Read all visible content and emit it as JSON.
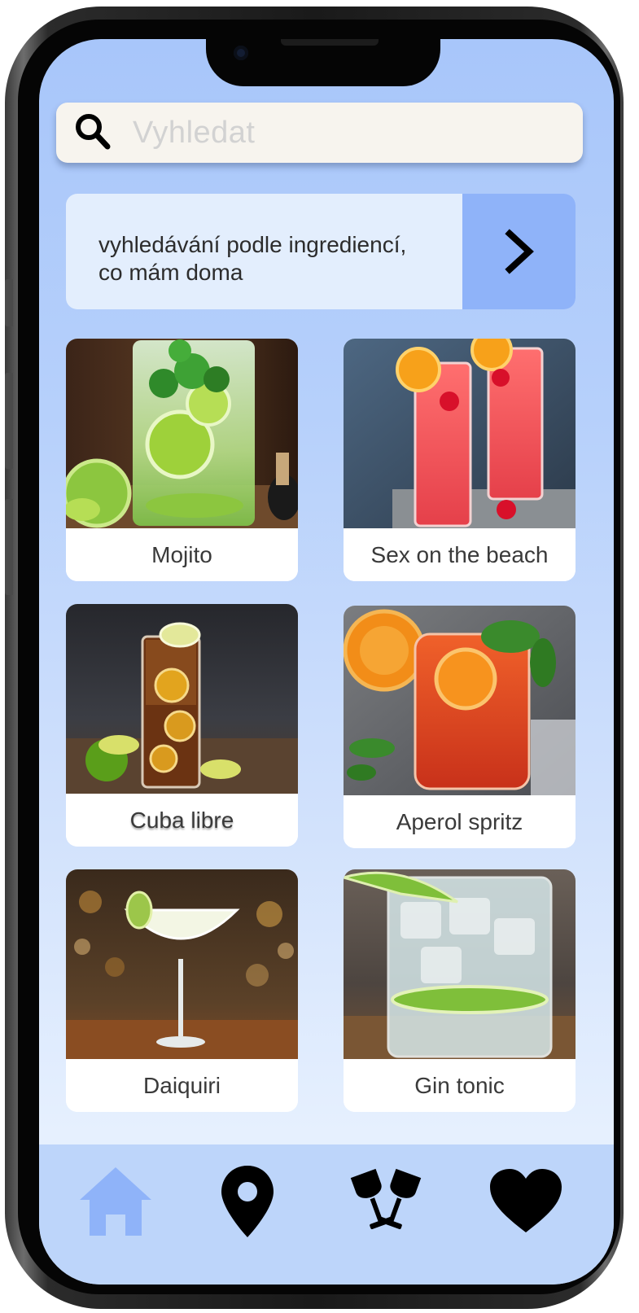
{
  "search": {
    "placeholder": "Vyhledat",
    "icon": "search-icon"
  },
  "ingredient_banner": {
    "text_line1": "vyhledávání podle ingrediencí,",
    "text_line2": "co mám doma",
    "arrow_icon": "chevron-right-icon"
  },
  "cocktails": [
    {
      "name": "Mojito"
    },
    {
      "name": "Sex on the beach"
    },
    {
      "name": "Cuba libre"
    },
    {
      "name": "Aperol spritz"
    },
    {
      "name": "Daiquiri"
    },
    {
      "name": "Gin tonic"
    }
  ],
  "bottom_nav": {
    "items": [
      {
        "icon": "home-icon",
        "active": true
      },
      {
        "icon": "location-pin-icon",
        "active": false
      },
      {
        "icon": "cheers-glasses-icon",
        "active": false
      },
      {
        "icon": "heart-icon",
        "active": false
      }
    ]
  },
  "colors": {
    "active_nav": "#8fb3f9",
    "inactive_nav": "#000000",
    "banner_arrow_bg": "#8fb3f9",
    "nav_bg": "#bdd5fa"
  }
}
